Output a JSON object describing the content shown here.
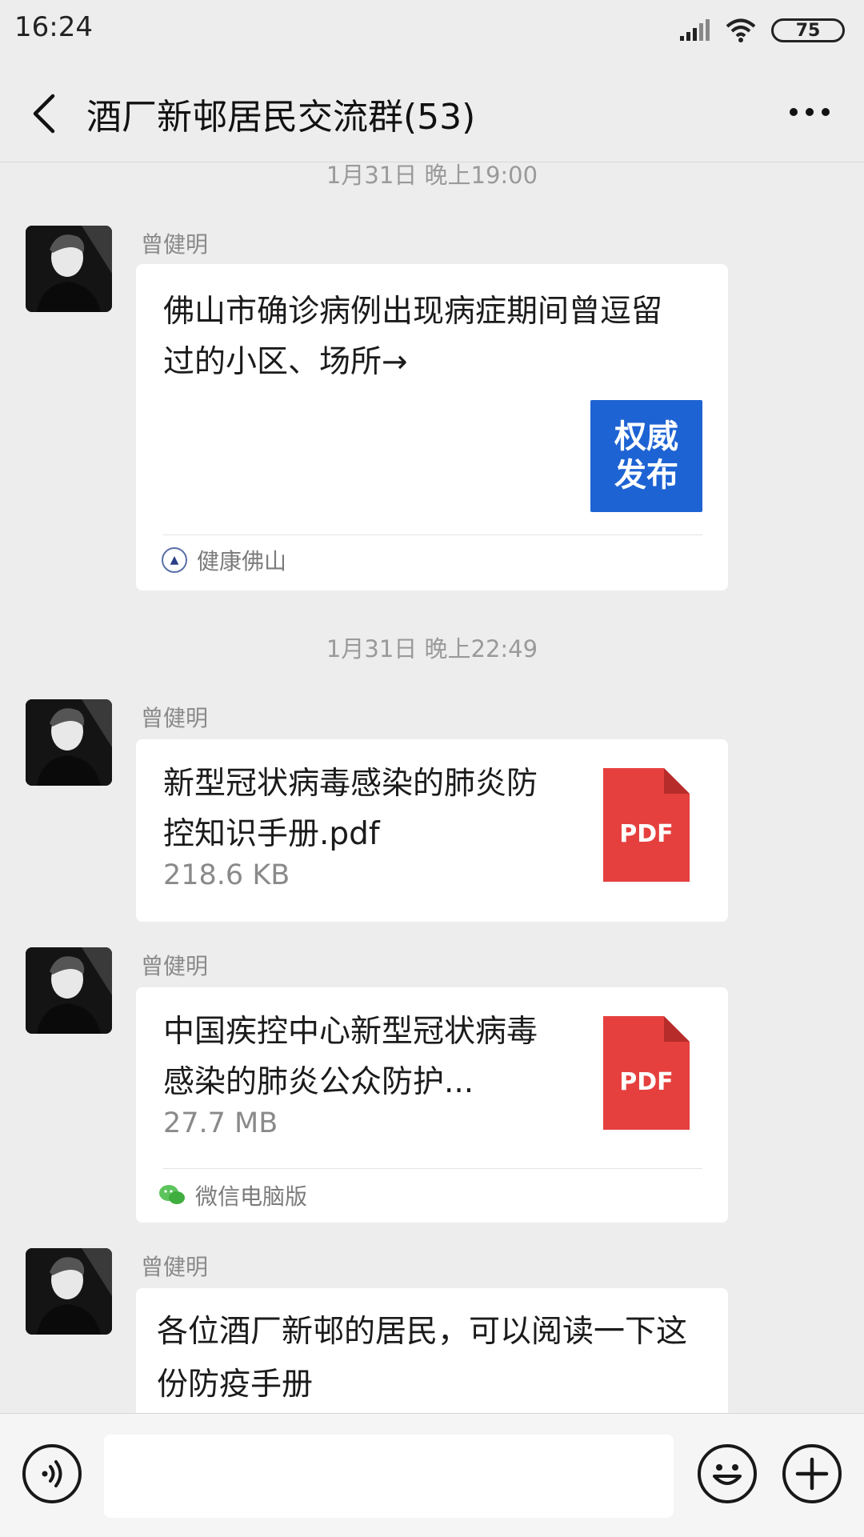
{
  "status_bar": {
    "time": "16:24",
    "battery": "75"
  },
  "header": {
    "title": "酒厂新邨居民交流群(53)",
    "back_icon": "chevron-left-icon",
    "more_icon": "more-horizontal-icon"
  },
  "messages": [
    {
      "type": "timestamp",
      "text": "1月31日 晚上19:00"
    },
    {
      "type": "link",
      "sender": "曾健明",
      "title": "佛山市确诊病例出现病症期间曾逗留过的小区、场所→",
      "thumb_line1": "权威",
      "thumb_line2": "发布",
      "thumb_color": "#1e63d3",
      "source": "健康佛山"
    },
    {
      "type": "timestamp",
      "text": "1月31日 晚上22:49"
    },
    {
      "type": "file",
      "sender": "曾健明",
      "filename": "新型冠状病毒感染的肺炎防控知识手册.pdf",
      "size": "218.6 KB",
      "icon_label": "PDF",
      "icon_color": "#e5403e"
    },
    {
      "type": "file",
      "sender": "曾健明",
      "filename": "中国疾控中心新型冠状病毒感染的肺炎公众防护...",
      "size": "27.7 MB",
      "icon_label": "PDF",
      "icon_color": "#e5403e",
      "source": "微信电脑版"
    },
    {
      "type": "text",
      "sender": "曾健明",
      "text": "各位酒厂新邨的居民，可以阅读一下这份防疫手册"
    }
  ],
  "input_bar": {
    "voice_icon": "voice-icon",
    "emoji_icon": "emoji-icon",
    "plus_icon": "plus-icon"
  }
}
